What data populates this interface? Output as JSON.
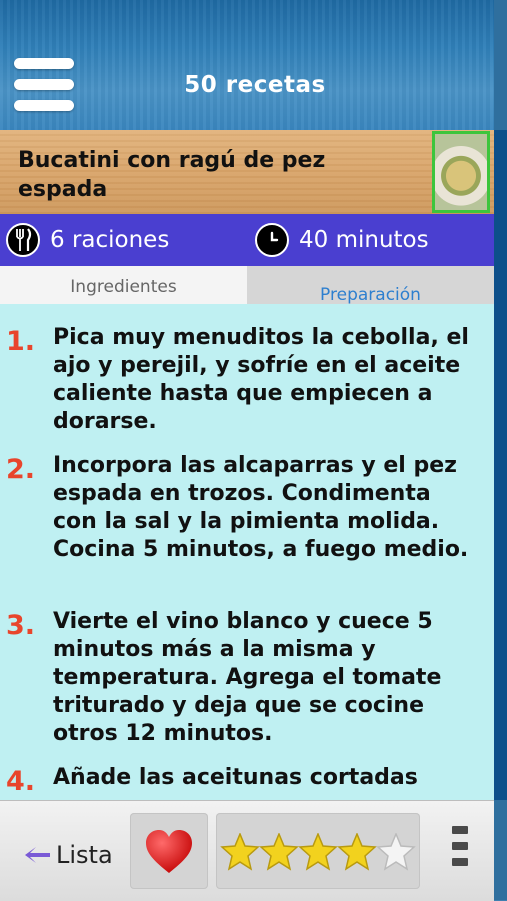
{
  "header": {
    "title": "50 recetas",
    "menu_icon": "hamburger-menu-icon"
  },
  "recipe": {
    "title": "Bucatini con ragú de pez espada",
    "servings": "6 raciones",
    "time": "40 minutos",
    "servings_icon": "cutlery-icon",
    "time_icon": "clock-icon"
  },
  "tabs": {
    "ingredients": "Ingredientes",
    "preparation": "Preparación",
    "active": "preparation"
  },
  "steps": [
    {
      "num": "1.",
      "text": "Pica muy menuditos la cebolla, el ajo y perejil, y sofríe en el aceite caliente hasta que empiecen a dorarse."
    },
    {
      "num": "2.",
      "text": "Incorpora las alcaparras y el pez espada en trozos. Condimenta con la sal y la pimienta molida. Cocina 5 minutos, a fuego medio."
    },
    {
      "num": "3.",
      "text": "Vierte el vino blanco y cuece 5 minutos más a la misma y temperatura. Agrega el tomate triturado y deja que se cocine otros 12 minutos."
    },
    {
      "num": "4.",
      "text": "Añade las aceitunas cortadas"
    }
  ],
  "bottom_bar": {
    "back_label": "Lista",
    "favorite_icon": "heart-icon",
    "rating": 4,
    "rating_max": 5,
    "more_icon": "more-vertical-icon"
  },
  "colors": {
    "info_bar": "#4a3fd0",
    "content_bg": "#bff0f2",
    "step_number": "#e8452c",
    "heart": "#e01818",
    "star": "#f2d21e"
  }
}
